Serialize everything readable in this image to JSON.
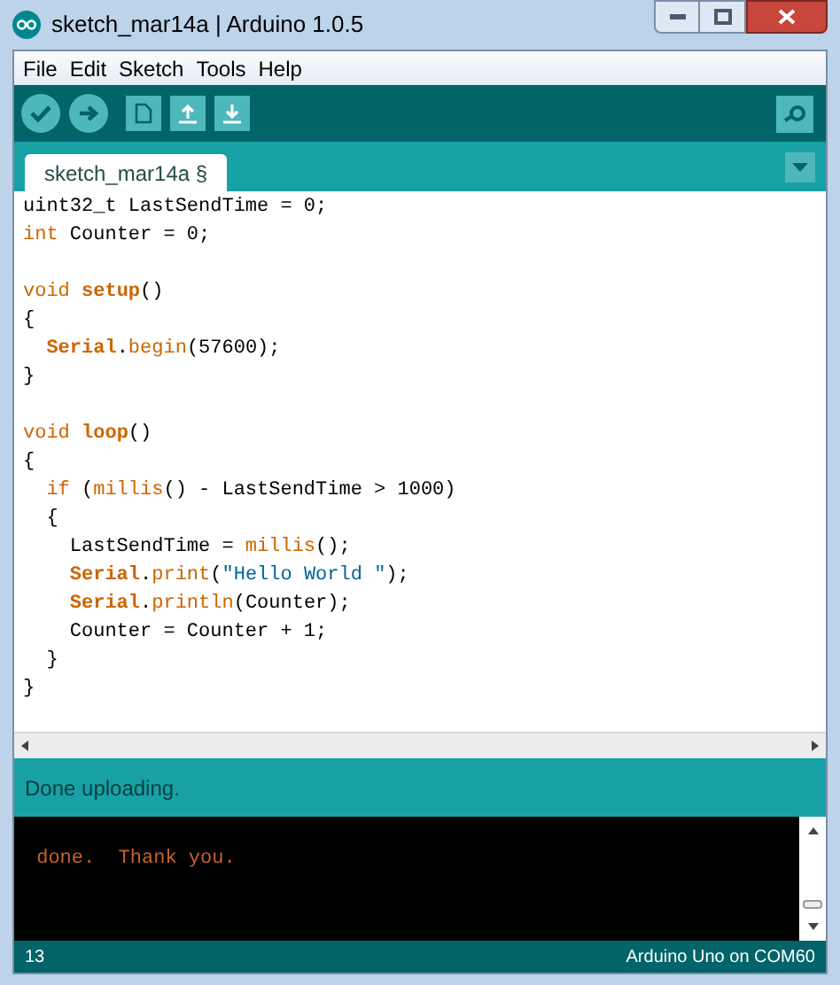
{
  "window": {
    "title": "sketch_mar14a | Arduino 1.0.5"
  },
  "menu": [
    "File",
    "Edit",
    "Sketch",
    "Tools",
    "Help"
  ],
  "tabs": [
    {
      "label": "sketch_mar14a §",
      "selected": true
    }
  ],
  "code": [
    {
      "kind": "code",
      "tokens": [
        {
          "kind": "text",
          "text": "uint32_t LastSendTime = 0;"
        }
      ]
    },
    {
      "kind": "code",
      "tokens": [
        {
          "kind": "type",
          "text": "int"
        },
        {
          "kind": "text",
          "text": " Counter = 0;"
        }
      ]
    },
    {
      "kind": "blank"
    },
    {
      "kind": "code",
      "tokens": [
        {
          "kind": "type",
          "text": "void "
        },
        {
          "kind": "bold",
          "text": "setup"
        },
        {
          "kind": "text",
          "text": "()"
        }
      ]
    },
    {
      "kind": "code",
      "tokens": [
        {
          "kind": "text",
          "text": "{"
        }
      ]
    },
    {
      "kind": "code",
      "tokens": [
        {
          "kind": "bold",
          "text": "  Serial"
        },
        {
          "kind": "text",
          "text": "."
        },
        {
          "kind": "func",
          "text": "begin"
        },
        {
          "kind": "text",
          "text": "(57600);"
        }
      ]
    },
    {
      "kind": "code",
      "tokens": [
        {
          "kind": "text",
          "text": "}"
        }
      ]
    },
    {
      "kind": "blank"
    },
    {
      "kind": "code",
      "tokens": [
        {
          "kind": "type",
          "text": "void "
        },
        {
          "kind": "bold",
          "text": "loop"
        },
        {
          "kind": "text",
          "text": "()"
        }
      ]
    },
    {
      "kind": "code",
      "tokens": [
        {
          "kind": "text",
          "text": "{"
        }
      ]
    },
    {
      "kind": "code",
      "tokens": [
        {
          "kind": "type",
          "text": "  if"
        },
        {
          "kind": "text",
          "text": " ("
        },
        {
          "kind": "func",
          "text": "millis"
        },
        {
          "kind": "text",
          "text": "() - LastSendTime > 1000)"
        }
      ]
    },
    {
      "kind": "code",
      "tokens": [
        {
          "kind": "text",
          "text": "  {"
        }
      ]
    },
    {
      "kind": "code",
      "tokens": [
        {
          "kind": "text",
          "text": "    LastSendTime = "
        },
        {
          "kind": "func",
          "text": "millis"
        },
        {
          "kind": "text",
          "text": "();"
        }
      ]
    },
    {
      "kind": "code",
      "tokens": [
        {
          "kind": "bold",
          "text": "    Serial"
        },
        {
          "kind": "text",
          "text": "."
        },
        {
          "kind": "func",
          "text": "print"
        },
        {
          "kind": "text",
          "text": "("
        },
        {
          "kind": "string",
          "text": "\"Hello World \""
        },
        {
          "kind": "text",
          "text": ");"
        }
      ]
    },
    {
      "kind": "code",
      "tokens": [
        {
          "kind": "bold",
          "text": "    Serial"
        },
        {
          "kind": "text",
          "text": "."
        },
        {
          "kind": "func",
          "text": "println"
        },
        {
          "kind": "text",
          "text": "(Counter);"
        }
      ]
    },
    {
      "kind": "code",
      "tokens": [
        {
          "kind": "text",
          "text": "    Counter = Counter + 1;"
        }
      ]
    },
    {
      "kind": "code",
      "tokens": [
        {
          "kind": "text",
          "text": "  }"
        }
      ]
    },
    {
      "kind": "code",
      "tokens": [
        {
          "kind": "text",
          "text": "}"
        }
      ]
    }
  ],
  "status": "Done uploading.",
  "console": [
    " done.  Thank you."
  ],
  "status_bar": {
    "line": "13",
    "board": "Arduino Uno on COM60"
  }
}
